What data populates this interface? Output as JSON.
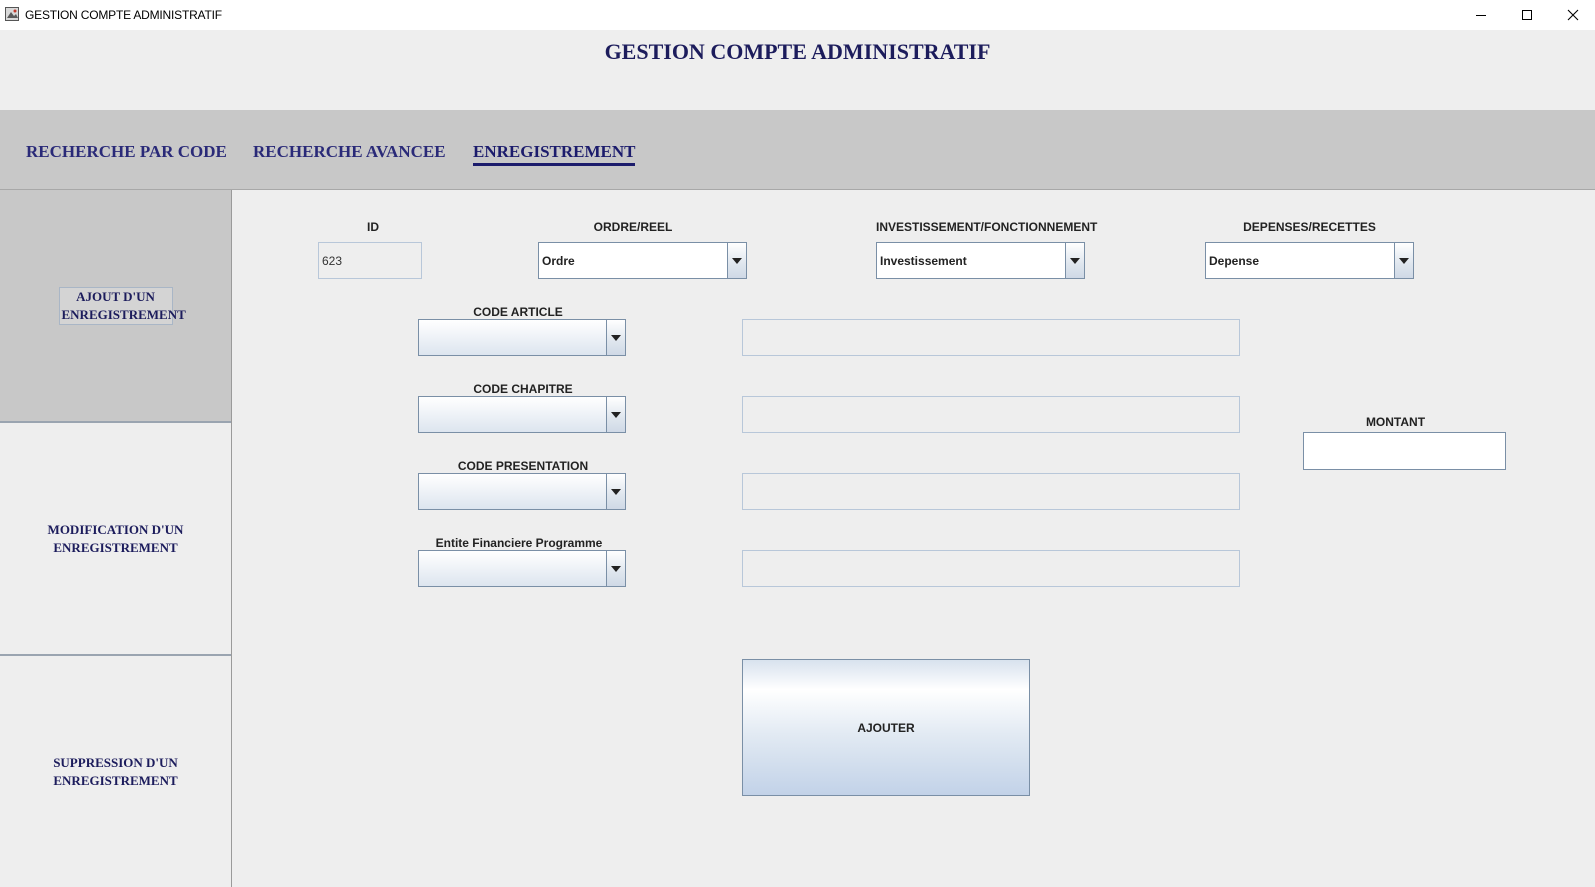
{
  "window": {
    "title": "GESTION COMPTE ADMINISTRATIF",
    "icons": [
      "app-icon",
      "minimize-icon",
      "maximize-icon",
      "close-icon"
    ]
  },
  "header": {
    "title": "GESTION COMPTE ADMINISTRATIF"
  },
  "nav": {
    "tabs": [
      {
        "label": "RECHERCHE PAR CODE"
      },
      {
        "label": "RECHERCHE AVANCEE"
      },
      {
        "label": "ENREGISTREMENT",
        "active": true
      }
    ]
  },
  "sidebar": {
    "items": [
      {
        "label": "AJOUT D'UN ENREGISTREMENT",
        "active": true
      },
      {
        "label": "MODIFICATION D'UN ENREGISTREMENT"
      },
      {
        "label": "SUPPRESSION D'UN ENREGISTREMENT"
      }
    ]
  },
  "form": {
    "id": {
      "label": "ID",
      "value": "623"
    },
    "ordre_reel": {
      "label": "ORDRE/REEL",
      "value": "Ordre"
    },
    "invest_fonct": {
      "label": "INVESTISSEMENT/FONCTIONNEMENT",
      "value": "Investissement"
    },
    "depenses_recettes": {
      "label": "DEPENSES/RECETTES",
      "value": "Depense"
    },
    "code_article": {
      "label": "CODE ARTICLE",
      "value": "",
      "description": ""
    },
    "code_chapitre": {
      "label": "CODE CHAPITRE",
      "value": "",
      "description": ""
    },
    "code_presentation": {
      "label": "CODE PRESENTATION",
      "value": "",
      "description": ""
    },
    "entite_financiere": {
      "label": "Entite Financiere Programme",
      "value": "",
      "description": ""
    },
    "montant": {
      "label": "MONTANT",
      "value": ""
    },
    "submit_label": "AJOUTER"
  },
  "colors": {
    "title_navy": "#1c1c5c",
    "nav_band": "#c8c8c8",
    "background": "#eeeeee",
    "field_border": "#7a8fa6"
  }
}
